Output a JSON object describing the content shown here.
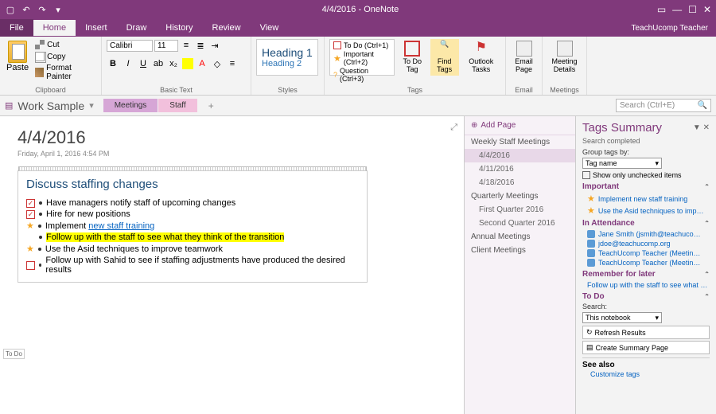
{
  "titlebar": {
    "title": "4/4/2016 - OneNote"
  },
  "menu": {
    "file": "File",
    "tabs": [
      "Home",
      "Insert",
      "Draw",
      "History",
      "Review",
      "View"
    ],
    "active": 0,
    "teacher": "TeachUcomp Teacher"
  },
  "ribbon": {
    "clipboard": {
      "paste": "Paste",
      "cut": "Cut",
      "copy": "Copy",
      "painter": "Format Painter",
      "label": "Clipboard"
    },
    "basictext": {
      "font": "Calibri",
      "size": "11",
      "label": "Basic Text"
    },
    "styles": {
      "h1": "Heading 1",
      "h2": "Heading 2",
      "label": "Styles"
    },
    "tags": {
      "todo": "To Do (Ctrl+1)",
      "important": "Important (Ctrl+2)",
      "question": "Question (Ctrl+3)",
      "todo_btn": "To Do Tag",
      "find": "Find Tags",
      "outlook": "Outlook Tasks",
      "label": "Tags"
    },
    "email": {
      "btn": "Email Page",
      "label": "Email"
    },
    "meetings": {
      "btn": "Meeting Details",
      "label": "Meetings"
    }
  },
  "notebook": {
    "name": "Work Sample",
    "tabs": [
      {
        "label": "Meetings",
        "cls": "meetings"
      },
      {
        "label": "Staff",
        "cls": "staff"
      }
    ],
    "search_ph": "Search (Ctrl+E)"
  },
  "page": {
    "title": "4/4/2016",
    "date": "Friday, April 1, 2016        4:54 PM",
    "note_title": "Discuss staffing changes",
    "items": [
      {
        "tag": "chk",
        "checked": true,
        "text": "Have managers notify staff of upcoming changes"
      },
      {
        "tag": "chk",
        "checked": true,
        "text": "Hire for new positions"
      },
      {
        "tag": "star",
        "text": "Implement ",
        "link": "new staff training"
      },
      {
        "tag": "none",
        "hl": true,
        "text": "Follow up with the staff to see what they think of the transition"
      },
      {
        "tag": "star",
        "text": "Use the Asid techniques to improve teamwork"
      },
      {
        "tag": "chk",
        "checked": false,
        "text": "Follow up with Sahid to see if staffing adjustments have produced the desired results"
      }
    ],
    "todo_label": "To Do"
  },
  "pages": {
    "add": "Add Page",
    "groups": [
      {
        "name": "Weekly Staff Meetings",
        "items": [
          "4/4/2016",
          "4/11/2016",
          "4/18/2016"
        ],
        "sel": 0
      },
      {
        "name": "Quarterly Meetings",
        "items": [
          "First Quarter 2016",
          "Second Quarter 2016"
        ]
      },
      {
        "name": "Annual Meetings",
        "items": []
      },
      {
        "name": "Client Meetings",
        "items": []
      }
    ]
  },
  "tags_pane": {
    "title": "Tags Summary",
    "completed": "Search completed",
    "group_by_label": "Group tags by:",
    "group_by": "Tag name",
    "show_unchecked": "Show only unchecked items",
    "groups": [
      {
        "name": "Important",
        "icon": "star",
        "items": [
          "Implement new staff training",
          "Use the Asid techniques to imp…"
        ]
      },
      {
        "name": "In Attendance",
        "icon": "person",
        "items": [
          "Jane Smith (jsmith@teachuco…",
          "jdoe@teachucomp.org",
          "TeachUcomp Teacher (Meetin…",
          "TeachUcomp Teacher (Meetin…"
        ]
      },
      {
        "name": "Remember for later",
        "icon": "none",
        "items": [
          "Follow up with the staff to see what …"
        ]
      },
      {
        "name": "To Do",
        "icon": "none",
        "items": []
      }
    ],
    "search_label": "Search:",
    "search_scope": "This notebook",
    "refresh": "Refresh Results",
    "summary": "Create Summary Page",
    "see_also": "See also",
    "customize": "Customize tags"
  }
}
